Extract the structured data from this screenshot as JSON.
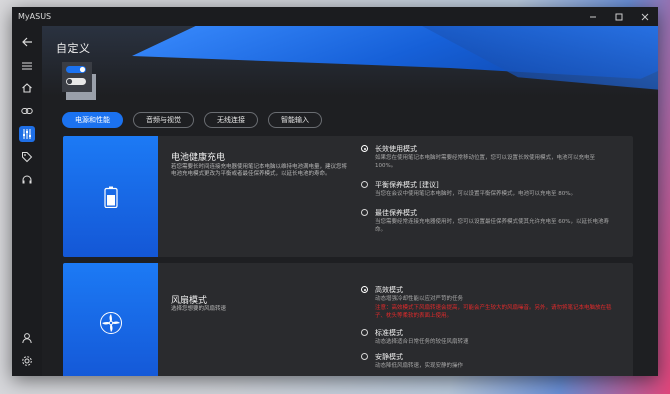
{
  "window": {
    "title": "MyASUS"
  },
  "page": {
    "title": "自定义"
  },
  "tabs": [
    {
      "label": "电源和性能",
      "active": true
    },
    {
      "label": "音频与视觉",
      "active": false
    },
    {
      "label": "无线连接",
      "active": false
    },
    {
      "label": "智能输入",
      "active": false
    }
  ],
  "sidebar": {
    "items": [
      {
        "icon": "back-arrow-icon"
      },
      {
        "icon": "menu-icon"
      },
      {
        "icon": "home-icon"
      },
      {
        "icon": "link-icon"
      },
      {
        "icon": "sliders-icon",
        "active": true
      },
      {
        "icon": "tag-icon"
      },
      {
        "icon": "headset-icon"
      },
      {
        "icon": "user-icon"
      },
      {
        "icon": "settings-icon"
      }
    ]
  },
  "battery": {
    "title": "电池健康充电",
    "desc": "若您需要长时间连接充电器使用笔记本电脑以维持电池满电量，建议您将电池充电模式更改为平衡或者最佳保养模式，以延长电池的寿命。",
    "options": [
      {
        "title": "长效使用模式",
        "desc": "如果您在使用笔记本电脑时需要经常移动位置，您可以设置长效使用模式，电池可以充电至 100%。",
        "checked": true
      },
      {
        "title": "平衡保养模式 [建议]",
        "desc": "当您在会议中使用笔记本电脑时，可以设置平衡保养模式，电池可以充电至 80%。",
        "checked": false
      },
      {
        "title": "最佳保养模式",
        "desc": "当您需要经常连接充电器使用时，您可以设置最佳保养模式使其允许充电至 60%，以延长电池寿命。",
        "checked": false
      }
    ]
  },
  "fan": {
    "title": "风扇模式",
    "desc": "选择您想要的风扇转速",
    "options": [
      {
        "title": "高效模式",
        "desc": "动态增强冷却性能以应对严苛的任务",
        "warning": "注意：高效模式下风扇转速会提高，可能会产生较大的风扇噪音。另外，请勿将笔记本电脑放在毯子、枕头等柔软的表面上使用。",
        "checked": true
      },
      {
        "title": "标准模式",
        "desc": "动态选择适合日常任务的较佳风扇转速",
        "checked": false
      },
      {
        "title": "安静模式",
        "desc": "动态降低风扇转速，实现安静的操作",
        "checked": false
      }
    ]
  },
  "colors": {
    "accent": "#1b72f0",
    "panel": "#2a2b2e",
    "window": "#1b1c1f",
    "warning": "#e22b2b"
  }
}
